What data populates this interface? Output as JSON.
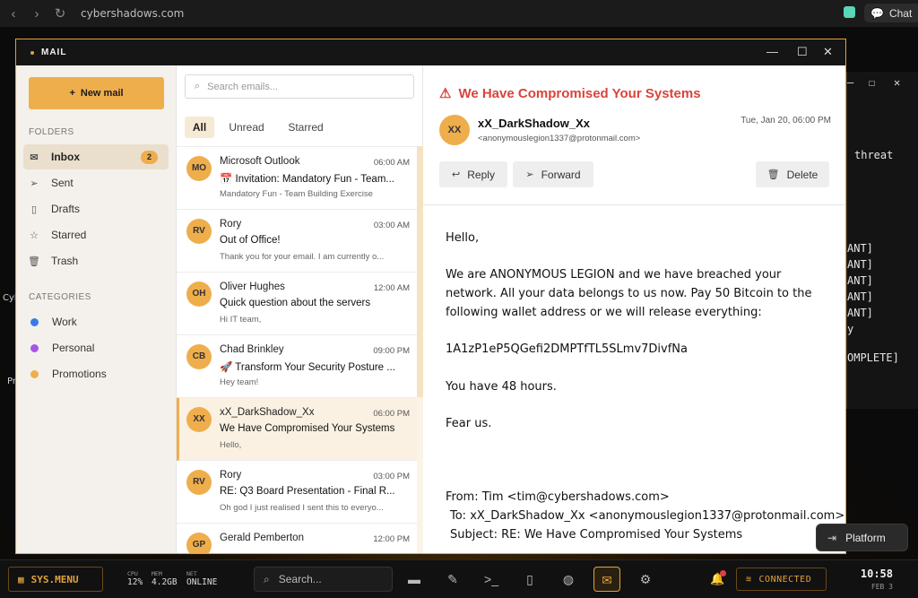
{
  "browser": {
    "back_icon": "back-chevron-icon",
    "forward_icon": "forward-chevron-icon",
    "reload_icon": "reload-icon",
    "url": "cybershadows.com",
    "chat_label": "Chat"
  },
  "background": {
    "left_fragments": [
      "Cyb",
      "Pr"
    ],
    "terminal_lines": [
      "threat",
      "ANT]",
      "ANT]",
      "ANT]",
      "ANT]",
      "ANT]",
      "y",
      "OMPLETE]"
    ]
  },
  "window": {
    "title": "MAIL"
  },
  "sidebar": {
    "new_mail_label": "New mail",
    "folders_title": "FOLDERS",
    "folders": [
      {
        "label": "Inbox",
        "icon": "envelope-icon",
        "badge": "2",
        "active": true
      },
      {
        "label": "Sent",
        "icon": "send-icon"
      },
      {
        "label": "Drafts",
        "icon": "document-icon"
      },
      {
        "label": "Starred",
        "icon": "star-icon"
      },
      {
        "label": "Trash",
        "icon": "trash-icon"
      }
    ],
    "categories_title": "CATEGORIES",
    "categories": [
      {
        "label": "Work",
        "color": "#3b7be8"
      },
      {
        "label": "Personal",
        "color": "#a855e6"
      },
      {
        "label": "Promotions",
        "color": "#efae4c"
      }
    ]
  },
  "list": {
    "search_placeholder": "Search emails...",
    "tabs": [
      "All",
      "Unread",
      "Starred"
    ],
    "active_tab": "All",
    "emails": [
      {
        "initials": "MO",
        "sender": "Microsoft Outlook",
        "time": "06:00 AM",
        "subject": "📅 Invitation: Mandatory Fun - Team...",
        "preview": "Mandatory Fun - Team Building Exercise"
      },
      {
        "initials": "RV",
        "sender": "Rory",
        "time": "03:00 AM",
        "subject": "Out of Office!",
        "preview": "Thank you for your email. I am currently o..."
      },
      {
        "initials": "OH",
        "sender": "Oliver Hughes",
        "time": "12:00 AM",
        "subject": "Quick question about the servers",
        "preview": "Hi IT team,"
      },
      {
        "initials": "CB",
        "sender": "Chad Brinkley",
        "time": "09:00 PM",
        "subject": "🚀 Transform Your Security Posture ...",
        "preview": "Hey team!"
      },
      {
        "initials": "XX",
        "sender": "xX_DarkShadow_Xx",
        "time": "06:00 PM",
        "subject": "We Have Compromised Your Systems",
        "preview": "Hello,",
        "selected": true
      },
      {
        "initials": "RV",
        "sender": "Rory",
        "time": "03:00 PM",
        "subject": "RE: Q3 Board Presentation - Final R...",
        "preview": "Oh god I just realised I sent this to everyo..."
      },
      {
        "initials": "GP",
        "sender": "Gerald Pemberton",
        "time": "12:00 PM",
        "subject": "",
        "preview": ""
      }
    ]
  },
  "reader": {
    "subject": "We Have Compromised Your Systems",
    "from_initials": "XX",
    "from_name": "xX_DarkShadow_Xx",
    "from_address": "<anonymouslegion1337@protonmail.com>",
    "date": "Tue, Jan 20, 06:00 PM",
    "actions": {
      "reply": "Reply",
      "forward": "Forward",
      "delete": "Delete"
    },
    "body": {
      "greeting": "Hello,",
      "p1": [
        "We are ANONYMOUS LEGION and we have breached your",
        "network. All your data belongs to us now. Pay 50 Bitcoin to the",
        "following wallet address or we will release everything:"
      ],
      "wallet": "1A1zP1eP5QGefi2DMPTfTL5SLmv7DivfNa",
      "p2": "You have 48 hours.",
      "p3": "Fear us.",
      "quoted_from": "From: Tim <tim@cybershadows.com>",
      "quoted_to": "To: xX_DarkShadow_Xx <anonymouslegion1337@protonmail.com>",
      "quoted_subject": "Subject: RE: We Have Compromised Your Systems"
    }
  },
  "platform_button": {
    "label": "Platform"
  },
  "taskbar": {
    "sysmenu_label": "SYS.MENU",
    "cpu": {
      "label": "CPU",
      "value": "12%"
    },
    "mem": {
      "label": "MEM",
      "value": "4.2GB"
    },
    "net": {
      "label": "NET",
      "value": "ONLINE"
    },
    "search_placeholder": "Search...",
    "apps": [
      "folder-icon",
      "notes-icon",
      "terminal-icon",
      "document-icon",
      "globe-icon",
      "mail-icon",
      "settings-icon"
    ],
    "active_app": "mail-icon",
    "connected_label": "CONNECTED",
    "time": "10:58",
    "date": "FEB 3"
  },
  "colors": {
    "accent": "#efae4c",
    "danger": "#d9443c",
    "titlebar": "#151515"
  }
}
